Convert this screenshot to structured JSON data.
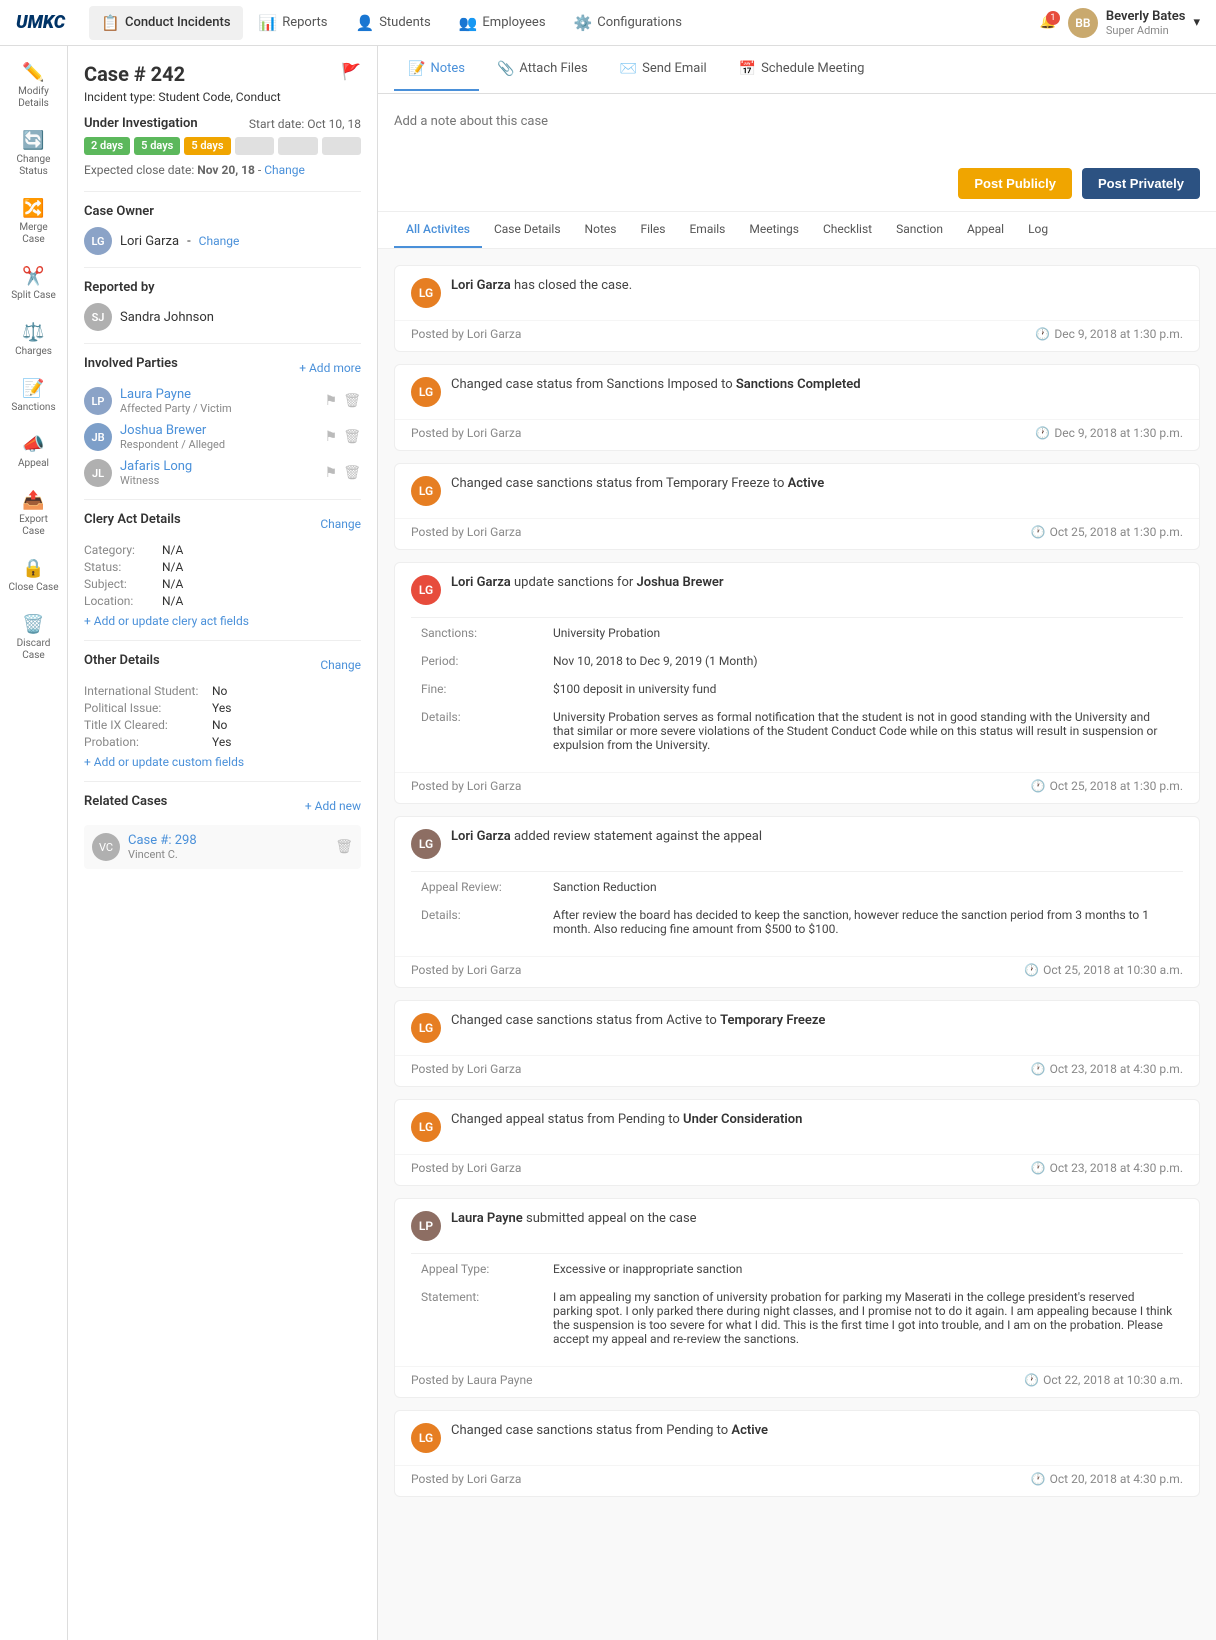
{
  "app": {
    "logo": "UMKC"
  },
  "topNav": {
    "items": [
      {
        "id": "conduct",
        "label": "Conduct Incidents",
        "icon": "📋",
        "active": true
      },
      {
        "id": "reports",
        "label": "Reports",
        "icon": "📊",
        "active": false
      },
      {
        "id": "students",
        "label": "Students",
        "icon": "👤",
        "active": false
      },
      {
        "id": "employees",
        "label": "Employees",
        "icon": "👥",
        "active": false
      },
      {
        "id": "configurations",
        "label": "Configurations",
        "icon": "⚙️",
        "active": false
      }
    ],
    "user": {
      "name": "Beverly Bates",
      "role": "Super Admin",
      "initials": "BB"
    },
    "notifications": "1"
  },
  "leftSidebar": {
    "items": [
      {
        "id": "modify",
        "label": "Modify Details",
        "icon": "✏️"
      },
      {
        "id": "change-status",
        "label": "Change Status",
        "icon": "🔄"
      },
      {
        "id": "merge",
        "label": "Merge Case",
        "icon": "🔀"
      },
      {
        "id": "split",
        "label": "Split Case",
        "icon": "✂️"
      },
      {
        "id": "charges",
        "label": "Charges",
        "icon": "⚖️"
      },
      {
        "id": "sanctions",
        "label": "Sanctions",
        "icon": "📝"
      },
      {
        "id": "appeal",
        "label": "Appeal",
        "icon": "📣"
      },
      {
        "id": "export",
        "label": "Export Case",
        "icon": "📤"
      },
      {
        "id": "close",
        "label": "Close Case",
        "icon": "🔒"
      },
      {
        "id": "discard",
        "label": "Discard Case",
        "icon": "🗑️",
        "danger": true
      }
    ]
  },
  "casePanel": {
    "caseNumber": "Case # 242",
    "incidentLabel": "Incident type:",
    "incidentType": "Student Code, Conduct",
    "status": {
      "label": "Under Investigation",
      "startDateLabel": "Start date:",
      "startDate": "Oct 10, 18"
    },
    "progressSteps": [
      {
        "label": "2 days",
        "type": "green"
      },
      {
        "label": "5 days",
        "type": "green"
      },
      {
        "label": "5 days",
        "type": "orange"
      }
    ],
    "expectedCloseLabel": "Expected close date:",
    "expectedCloseDate": "Nov 20, 18",
    "expectedCloseLink": "Change",
    "caseOwner": {
      "label": "Case Owner",
      "name": "Lori Garza",
      "initials": "LG",
      "changeLink": "Change"
    },
    "reportedBy": {
      "label": "Reported by",
      "name": "Sandra Johnson",
      "initials": "SJ"
    },
    "involvedParties": {
      "label": "Involved Parties",
      "addLink": "+ Add more",
      "parties": [
        {
          "name": "Laura Payne",
          "role": "Affected Party / Victim",
          "initials": "LP"
        },
        {
          "name": "Joshua Brewer",
          "role": "Respondent / Alleged",
          "initials": "JB"
        },
        {
          "name": "Jafaris Long",
          "role": "Witness",
          "initials": "JL"
        }
      ]
    },
    "cleryAct": {
      "label": "Clery Act Details",
      "changeLink": "Change",
      "fields": [
        {
          "label": "Category:",
          "value": "N/A"
        },
        {
          "label": "Status:",
          "value": "N/A"
        },
        {
          "label": "Subject:",
          "value": "N/A"
        },
        {
          "label": "Location:",
          "value": "N/A"
        }
      ],
      "addLink": "+ Add or update clery act fields"
    },
    "otherDetails": {
      "label": "Other Details",
      "changeLink": "Change",
      "fields": [
        {
          "label": "International Student:",
          "value": "No"
        },
        {
          "label": "Political Issue:",
          "value": "Yes"
        },
        {
          "label": "Title IX Cleared:",
          "value": "No"
        },
        {
          "label": "Probation:",
          "value": "Yes"
        }
      ],
      "addLink": "+ Add or update custom fields"
    },
    "relatedCases": {
      "label": "Related Cases",
      "addLink": "+ Add new",
      "cases": [
        {
          "caseNumber": "Case #: 298",
          "person": "Vincent C.",
          "initials": "VC"
        }
      ]
    }
  },
  "mainContent": {
    "topTabs": [
      {
        "id": "notes",
        "label": "Notes",
        "icon": "📝",
        "active": true
      },
      {
        "id": "attach-files",
        "label": "Attach Files",
        "icon": "📎",
        "active": false
      },
      {
        "id": "send-email",
        "label": "Send Email",
        "icon": "✉️",
        "active": false
      },
      {
        "id": "schedule-meeting",
        "label": "Schedule Meeting",
        "icon": "📅",
        "active": false
      }
    ],
    "noteInput": {
      "placeholder": "Add a note about this case",
      "postPubliclyLabel": "Post Publicly",
      "postPrivatelyLabel": "Post Privately"
    },
    "activityTabs": [
      {
        "id": "all-activities",
        "label": "All Activites",
        "active": true
      },
      {
        "id": "case-details",
        "label": "Case Details",
        "active": false
      },
      {
        "id": "notes",
        "label": "Notes",
        "active": false
      },
      {
        "id": "files",
        "label": "Files",
        "active": false
      },
      {
        "id": "emails",
        "label": "Emails",
        "active": false
      },
      {
        "id": "meetings",
        "label": "Meetings",
        "active": false
      },
      {
        "id": "checklist",
        "label": "Checklist",
        "active": false
      },
      {
        "id": "sanction",
        "label": "Sanction",
        "active": false
      },
      {
        "id": "appeal",
        "label": "Appeal",
        "active": false
      },
      {
        "id": "log",
        "label": "Log",
        "active": false
      }
    ],
    "activities": [
      {
        "id": "act1",
        "avatarInitials": "LG",
        "avatarColor": "orange",
        "message": "Lori Garza has closed the case.",
        "postedBy": "Posted by Lori Garza",
        "time": "Dec 9, 2018 at 1:30 p.m.",
        "type": "simple"
      },
      {
        "id": "act2",
        "avatarInitials": "LG",
        "avatarColor": "orange",
        "message": "Changed case status from Sanctions Imposed to",
        "messageHighlight": "Sanctions Completed",
        "postedBy": "Posted by Lori Garza",
        "time": "Dec 9, 2018 at 1:30 p.m.",
        "type": "status-change"
      },
      {
        "id": "act3",
        "avatarInitials": "LG",
        "avatarColor": "orange",
        "message": "Changed case sanctions status from Temporary Freeze to",
        "messageHighlight": "Active",
        "postedBy": "Posted by Lori Garza",
        "time": "Oct 25, 2018 at 1:30 p.m.",
        "type": "status-change"
      },
      {
        "id": "act4",
        "avatarInitials": "LG",
        "avatarColor": "red",
        "message": "Lori Garza update sanctions for Joshua Brewer",
        "postedBy": "Posted by Lori Garza",
        "time": "Oct 25, 2018 at 1:30 p.m.",
        "type": "sanction-detail",
        "details": [
          {
            "label": "Sanctions:",
            "value": "University Probation"
          },
          {
            "label": "Period:",
            "value": "Nov 10, 2018 to Dec 9, 2019 (1 Month)"
          },
          {
            "label": "Fine:",
            "value": "$100 deposit in university fund"
          },
          {
            "label": "Details:",
            "value": "University Probation serves as formal notification that the student is not in good standing with the University and that similar or more severe violations of the Student Conduct Code while on this status will result in suspension or expulsion from the University."
          }
        ]
      },
      {
        "id": "act5",
        "avatarInitials": "LG",
        "avatarColor": "brown",
        "message": "Lori Garza added review statement against the appeal",
        "postedBy": "Posted by Lori Garza",
        "time": "Oct 25, 2018 at 10:30 a.m.",
        "type": "appeal-detail",
        "details": [
          {
            "label": "Appeal Review:",
            "value": "Sanction Reduction"
          },
          {
            "label": "Details:",
            "value": "After review the board has decided to keep the sanction, however reduce the sanction period from 3 months to 1 month. Also reducing fine amount from $500 to $100."
          }
        ]
      },
      {
        "id": "act6",
        "avatarInitials": "LG",
        "avatarColor": "orange",
        "message": "Changed case sanctions status from Active to",
        "messageHighlight": "Temporary Freeze",
        "postedBy": "Posted by Lori Garza",
        "time": "Oct 23, 2018 at 4:30 p.m.",
        "type": "status-change"
      },
      {
        "id": "act7",
        "avatarInitials": "LG",
        "avatarColor": "orange",
        "message": "Changed appeal status from Pending to",
        "messageHighlight": "Under Consideration",
        "postedBy": "Posted by Lori Garza",
        "time": "Oct 23, 2018 at 4:30 p.m.",
        "type": "status-change"
      },
      {
        "id": "act8",
        "avatarInitials": "LP",
        "avatarColor": "brown",
        "message": "Laura Payne submitted appeal on the case",
        "postedBy": "Posted by Laura Payne",
        "time": "Oct 22, 2018 at 10:30 a.m.",
        "type": "appeal-submitted",
        "details": [
          {
            "label": "Appeal Type:",
            "value": "Excessive or inappropriate sanction"
          },
          {
            "label": "Statement:",
            "value": "I am appealing my sanction of university probation for parking my Maserati in the college president's reserved parking spot. I only parked there during night classes, and I promise not to do it again. I am appealing because I think the suspension is too severe for what I did. This is the first time I got into trouble, and I am on the probation. Please accept my appeal and re-review the sanctions."
          }
        ]
      },
      {
        "id": "act9",
        "avatarInitials": "LG",
        "avatarColor": "orange",
        "message": "Changed case sanctions status from Pending to",
        "messageHighlight": "Active",
        "postedBy": "Posted by Lori Garza",
        "time": "Oct 20, 2018 at 4:30 p.m.",
        "type": "status-change"
      }
    ]
  }
}
